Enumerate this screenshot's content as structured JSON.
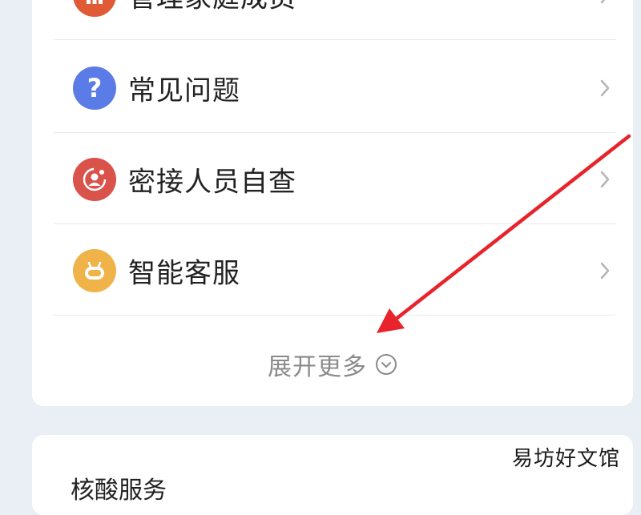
{
  "menu": {
    "items": [
      {
        "label": "管理家庭成员",
        "icon": "family-icon",
        "color": "#e05a35"
      },
      {
        "label": "常见问题",
        "icon": "question-icon",
        "color": "#5b7be6"
      },
      {
        "label": "密接人员自查",
        "icon": "contact-check-icon",
        "color": "#d9534b"
      },
      {
        "label": "智能客服",
        "icon": "robot-icon",
        "color": "#f0b34a"
      }
    ],
    "expand_label": "展开更多"
  },
  "bottom_card": {
    "title": "核酸服务"
  },
  "watermark": "易坊好文馆",
  "colors": {
    "background": "#eaeef5",
    "card": "#ffffff",
    "annotation_arrow": "#e8232b"
  }
}
